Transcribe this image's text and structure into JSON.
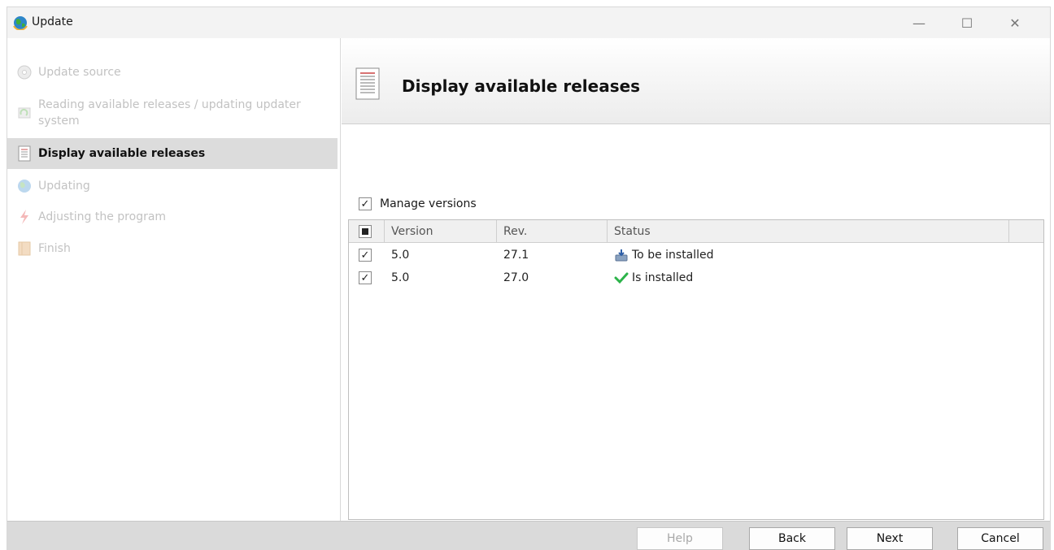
{
  "window": {
    "title": "Update"
  },
  "titlebar_buttons": {
    "minimize": "—",
    "maximize": "☐",
    "close": "✕"
  },
  "sidebar": {
    "steps": [
      {
        "label": "Update source",
        "icon": "disc-icon",
        "state": "done"
      },
      {
        "label": "Reading available releases / updating updater system",
        "icon": "refresh-icon",
        "state": "done"
      },
      {
        "label": "Display available releases",
        "icon": "list-document-icon",
        "state": "active"
      },
      {
        "label": "Updating",
        "icon": "globe-update-icon",
        "state": "pending"
      },
      {
        "label": "Adjusting the program",
        "icon": "lightning-icon",
        "state": "pending"
      },
      {
        "label": "Finish",
        "icon": "finish-icon",
        "state": "pending"
      }
    ]
  },
  "header": {
    "title": "Display available releases",
    "icon": "list-document-icon"
  },
  "manage_versions": {
    "label": "Manage versions",
    "checked": true,
    "check_glyph": "✓"
  },
  "table": {
    "columns": [
      "Version",
      "Rev.",
      "Status"
    ],
    "rows": [
      {
        "checked": true,
        "version": "5.0",
        "rev": "27.1",
        "status": "To be installed",
        "status_icon": "install-icon"
      },
      {
        "checked": true,
        "version": "5.0",
        "rev": "27.0",
        "status": "Is installed",
        "status_icon": "green-check-icon"
      }
    ]
  },
  "footer": {
    "help": "Help",
    "back": "Back",
    "next": "Next",
    "cancel": "Cancel"
  },
  "colors": {
    "active_step_bg": "#dcdcdc",
    "inactive_text": "#c2c2c2",
    "footer_bg": "#dadada",
    "check_green": "#2cb34a"
  }
}
